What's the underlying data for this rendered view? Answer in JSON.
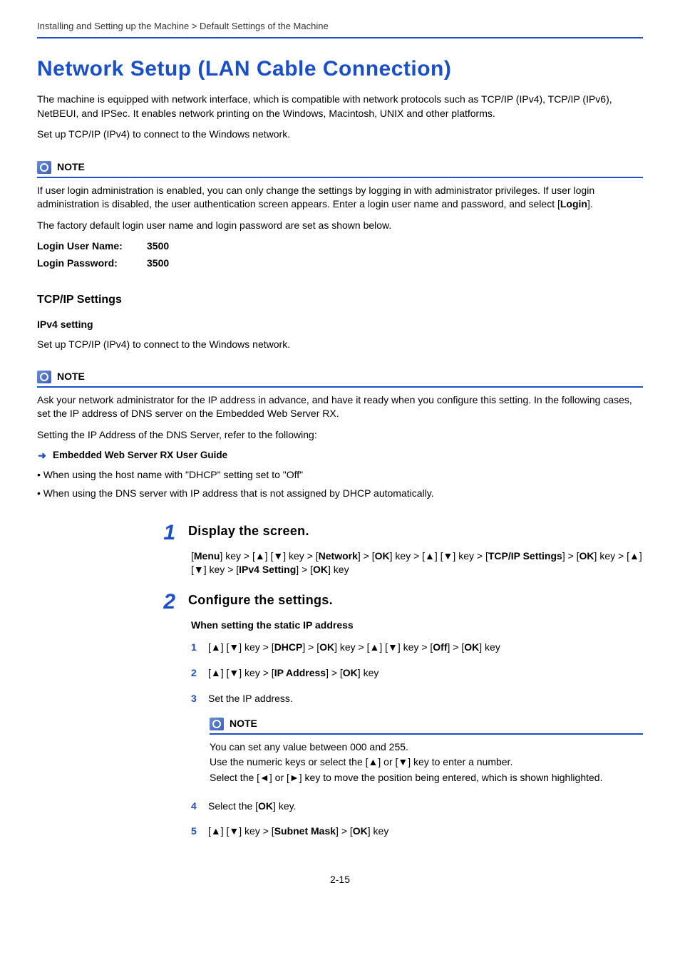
{
  "breadcrumb": "Installing and Setting up the Machine > Default Settings of the Machine",
  "title": "Network Setup (LAN Cable Connection)",
  "intro1": "The machine is equipped with network interface, which is compatible with network protocols such as TCP/IP (IPv4), TCP/IP (IPv6), NetBEUI, and IPSec. It enables network printing on the Windows, Macintosh, UNIX and other platforms.",
  "intro2": "Set up TCP/IP (IPv4) to connect to the Windows network.",
  "note1": {
    "label": "NOTE",
    "p1_a": "If user login administration is enabled, you can only change the settings by logging in with administrator privileges. If user login administration is disabled, the user authentication screen appears. Enter a login user name and password, and select [",
    "p1_b": "Login",
    "p1_c": "].",
    "p2": "The factory default login user name and login password are set as shown below.",
    "login_user_label": "Login User Name:",
    "login_user_value": "3500",
    "login_pass_label": "Login Password:",
    "login_pass_value": "3500"
  },
  "tcpip_heading": "TCP/IP Settings",
  "ipv4_heading": "IPv4 setting",
  "ipv4_intro": "Set up TCP/IP (IPv4) to connect to the Windows network.",
  "note2": {
    "label": "NOTE",
    "p1": "Ask your network administrator for the IP address in advance, and have it ready when you configure this setting. In the following cases, set the IP address of DNS server on the Embedded Web Server RX.",
    "p2": "Setting the IP Address of the DNS Server, refer to the following:",
    "link": "Embedded Web Server RX User Guide",
    "bullet1": "• When using the host name with \"DHCP\" setting set to \"Off\"",
    "bullet2": "• When using the DNS server with IP address that is not assigned by DHCP automatically."
  },
  "steps": {
    "s1": {
      "num": "1",
      "title": "Display the screen.",
      "body_parts": [
        "[",
        "Menu",
        "] key > [▲] [▼] key > [",
        "Network",
        "] > [",
        "OK",
        "] key > [▲] [▼] key > [",
        "TCP/IP Settings",
        "] > [",
        "OK",
        "] key > [▲] [▼] key > [",
        "IPv4 Setting",
        "] > [",
        "OK",
        "] key"
      ]
    },
    "s2": {
      "num": "2",
      "title": "Configure the settings.",
      "subheading": "When setting the static IP address",
      "subs": {
        "1": {
          "n": "1",
          "parts": [
            "[▲] [▼] key > [",
            "DHCP",
            "] > [",
            "OK",
            "] key > [▲] [▼] key > [",
            "Off",
            "] > [",
            "OK",
            "] key"
          ]
        },
        "2": {
          "n": "2",
          "parts": [
            "[▲] [▼] key > [",
            "IP Address",
            "] > [",
            "OK",
            "] key"
          ]
        },
        "3": {
          "n": "3",
          "text": "Set the IP address."
        },
        "4": {
          "n": "4",
          "parts": [
            "Select the [",
            "OK",
            "] key."
          ]
        },
        "5": {
          "n": "5",
          "parts": [
            "[▲] [▼] key > [",
            "Subnet Mask",
            "] > [",
            "OK",
            "] key"
          ]
        }
      },
      "note": {
        "label": "NOTE",
        "p1": "You can set any value between 000 and 255.",
        "p2": "Use the numeric keys or select the [▲] or [▼] key to enter a number.",
        "p3": "Select the [◄] or [►] key to move the position being entered, which is shown highlighted."
      }
    }
  },
  "page_footer": "2-15"
}
